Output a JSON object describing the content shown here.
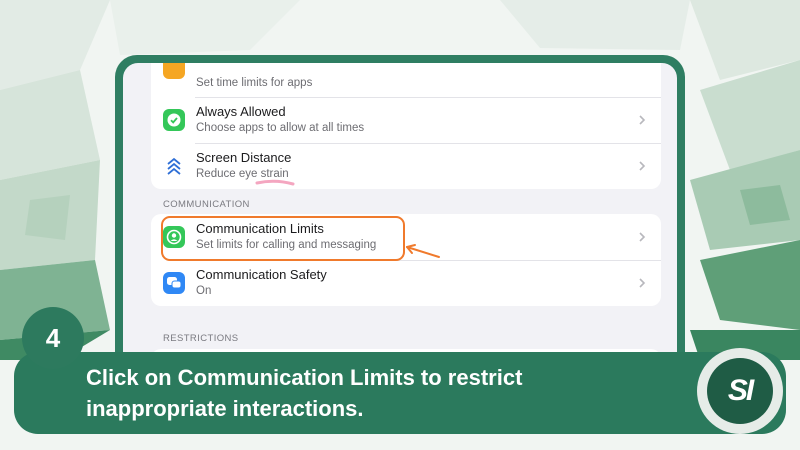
{
  "screen": {
    "top_group": {
      "rows": [
        {
          "subtitle": "Set time limits for apps",
          "icon": "hourglass-icon"
        },
        {
          "title": "Always Allowed",
          "subtitle": "Choose apps to allow at all times",
          "icon": "checkmark-badge-icon"
        },
        {
          "title": "Screen Distance",
          "subtitle": "Reduce eye strain",
          "icon": "chevrons-up-icon"
        }
      ]
    },
    "communication": {
      "header": "COMMUNICATION",
      "rows": [
        {
          "title": "Communication Limits",
          "subtitle": "Set limits for calling and messaging",
          "icon": "contact-circle-icon"
        },
        {
          "title": "Communication Safety",
          "subtitle": "On",
          "icon": "chat-bubbles-icon"
        }
      ]
    },
    "restrictions": {
      "header": "RESTRICTIONS"
    }
  },
  "tutorial": {
    "step": "4",
    "caption_line1": "Click on Communication Limits to restrict",
    "caption_line2": "inappropriate interactions.",
    "logo_text": "SI"
  },
  "colors": {
    "accent_green": "#2b7a5d",
    "highlight_orange": "#f07a2c",
    "app_green": "#34c759",
    "app_blue": "#2f88f5"
  }
}
